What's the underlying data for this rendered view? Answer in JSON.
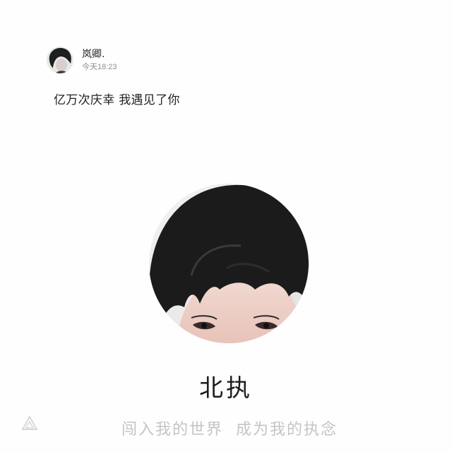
{
  "post": {
    "author_name": "岚卿.",
    "time": "今天18:23",
    "text": "亿万次庆幸 我遇见了你"
  },
  "profile": {
    "name": "北执",
    "bio": "闯入我的世界  成为我的执念"
  },
  "icons": {
    "author_avatar": "portrait-avatar",
    "profile_avatar": "portrait-photo",
    "watermark": "triangle-logo"
  },
  "colors": {
    "background": "#fefefe",
    "hair": "#1b1b1b",
    "skin": "#efd2cb",
    "bio_text": "#c4c4c4"
  }
}
